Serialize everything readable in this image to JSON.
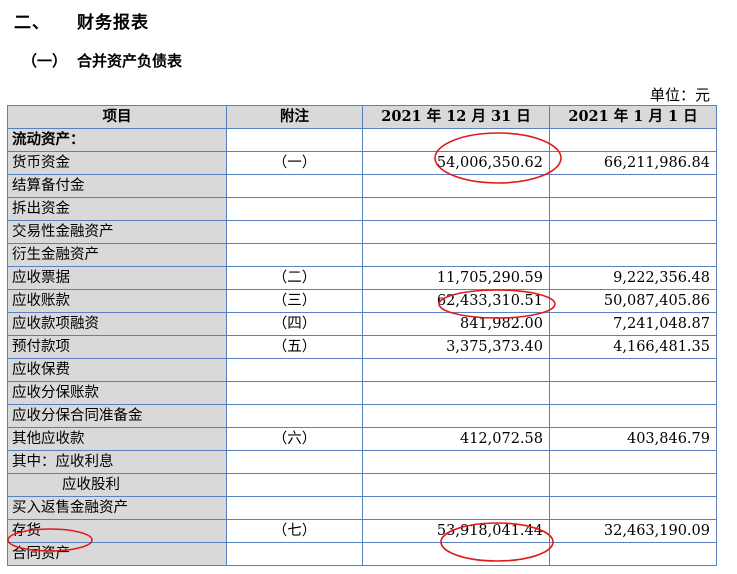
{
  "section": {
    "number": "二、",
    "title": "财务报表"
  },
  "subsection": {
    "number": "（一）",
    "title": "合并资产负债表"
  },
  "unit": "单位：元",
  "columns": [
    "项目",
    "附注",
    "2021 年 12 月 31 日",
    "2021 年 1 月 1 日"
  ],
  "rows": [
    {
      "item": "流动资产：",
      "note": "",
      "end": "",
      "start": "",
      "style": "bold"
    },
    {
      "item": "货币资金",
      "note": "（一）",
      "end": "54,006,350.62",
      "start": "66,211,986.84",
      "style": ""
    },
    {
      "item": "结算备付金",
      "note": "",
      "end": "",
      "start": "",
      "style": ""
    },
    {
      "item": "拆出资金",
      "note": "",
      "end": "",
      "start": "",
      "style": ""
    },
    {
      "item": "交易性金融资产",
      "note": "",
      "end": "",
      "start": "",
      "style": ""
    },
    {
      "item": "衍生金融资产",
      "note": "",
      "end": "",
      "start": "",
      "style": ""
    },
    {
      "item": "应收票据",
      "note": "（二）",
      "end": "11,705,290.59",
      "start": "9,222,356.48",
      "style": ""
    },
    {
      "item": "应收账款",
      "note": "（三）",
      "end": "62,433,310.51",
      "start": "50,087,405.86",
      "style": ""
    },
    {
      "item": "应收款项融资",
      "note": "（四）",
      "end": "841,982.00",
      "start": "7,241,048.87",
      "style": ""
    },
    {
      "item": "预付款项",
      "note": "（五）",
      "end": "3,375,373.40",
      "start": "4,166,481.35",
      "style": ""
    },
    {
      "item": "应收保费",
      "note": "",
      "end": "",
      "start": "",
      "style": ""
    },
    {
      "item": "应收分保账款",
      "note": "",
      "end": "",
      "start": "",
      "style": ""
    },
    {
      "item": "应收分保合同准备金",
      "note": "",
      "end": "",
      "start": "",
      "style": ""
    },
    {
      "item": "其他应收款",
      "note": "（六）",
      "end": "412,072.58",
      "start": "403,846.79",
      "style": ""
    },
    {
      "item": "其中：应收利息",
      "note": "",
      "end": "",
      "start": "",
      "style": ""
    },
    {
      "item": "应收股利",
      "note": "",
      "end": "",
      "start": "",
      "style": "indent"
    },
    {
      "item": "买入返售金融资产",
      "note": "",
      "end": "",
      "start": "",
      "style": ""
    },
    {
      "item": "存货",
      "note": "（七）",
      "end": "53,918,041.44",
      "start": "32,463,190.09",
      "style": ""
    },
    {
      "item": "合同资产",
      "note": "",
      "end": "",
      "start": "",
      "style": ""
    }
  ],
  "highlight_color": "#e01b1b"
}
